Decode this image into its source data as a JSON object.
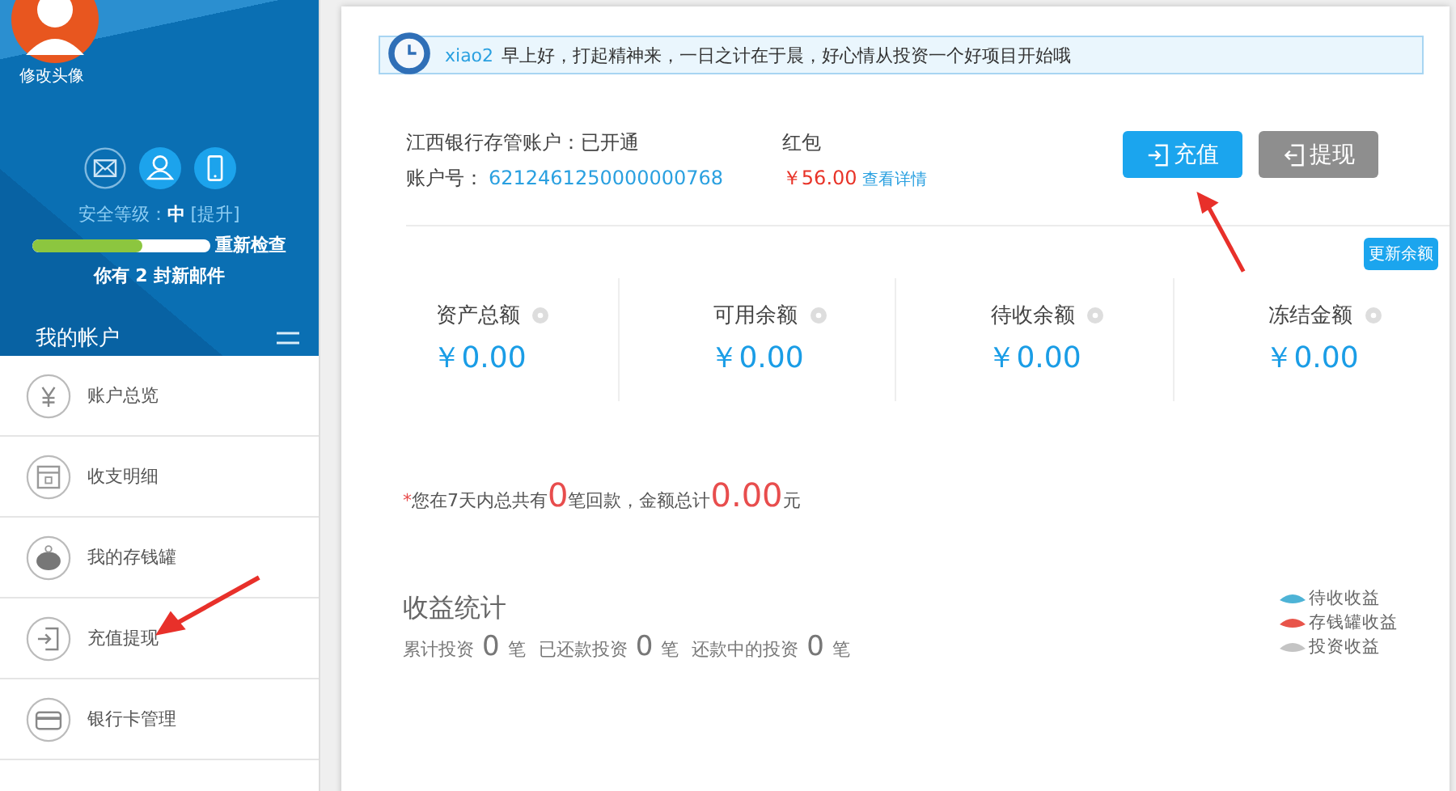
{
  "sidebar": {
    "avatar_label": "修改头像",
    "security_label": "安全等级：",
    "security_value": "中",
    "security_upgrade": "[提升]",
    "security": {
      "level": 0.62
    },
    "recheck": "重新检查",
    "mail_notice": "你有 2 封新邮件",
    "account_title": "我的帐户",
    "menu": [
      {
        "label": "账户总览",
        "selected": false
      },
      {
        "label": "收支明细",
        "selected": false
      },
      {
        "label": "我的存钱罐",
        "selected": false
      },
      {
        "label": "充值提现",
        "selected": false
      },
      {
        "label": "银行卡管理",
        "selected": false
      }
    ]
  },
  "greeting": {
    "user": "xiao2",
    "message": "早上好，打起精神来，一日之计在于晨，好心情从投资一个好项目开始哦"
  },
  "account": {
    "bank_status": "江西银行存管账户：已开通",
    "number_label": "账户号：",
    "number": "6212461250000000768",
    "red_packet_label": "红包",
    "red_packet_amount": "￥56.00",
    "details_link": "查看详情"
  },
  "buttons": [
    {
      "label": "充值",
      "kind": "primary"
    },
    {
      "label": "提现",
      "kind": "secondary"
    }
  ],
  "refresh_button": "更新余额",
  "balances": [
    {
      "label": "资产总额",
      "amount": "￥0.00"
    },
    {
      "label": "可用余额",
      "amount": "￥0.00"
    },
    {
      "label": "待收余额",
      "amount": "￥0.00"
    },
    {
      "label": "冻结金额",
      "amount": "￥0.00"
    }
  ],
  "repayment_notice": [
    {
      "text": "*",
      "kind": "mark"
    },
    {
      "text": "您在7天内总共有",
      "kind": "plain"
    },
    {
      "text": "0",
      "kind": "number"
    },
    {
      "text": "笔回款，金额总计",
      "kind": "plain"
    },
    {
      "text": "0.00",
      "kind": "number"
    },
    {
      "text": "元",
      "kind": "plain"
    }
  ],
  "stats": {
    "title": "收益统计",
    "summary": [
      {
        "text": "累计投资",
        "kind": "plain"
      },
      {
        "text": "0",
        "kind": "number"
      },
      {
        "text": "笔",
        "kind": "plain"
      },
      {
        "text": "已还款投资",
        "kind": "plain"
      },
      {
        "text": "0",
        "kind": "number"
      },
      {
        "text": "笔",
        "kind": "plain"
      },
      {
        "text": "还款中的投资",
        "kind": "plain"
      },
      {
        "text": "0",
        "kind": "number"
      },
      {
        "text": "笔",
        "kind": "plain"
      }
    ],
    "legend": [
      {
        "label": "待收收益",
        "color": "#4db3d6"
      },
      {
        "label": "存钱罐收益",
        "color": "#e8544a"
      },
      {
        "label": "投资收益",
        "color": "#c4c4c4"
      }
    ]
  }
}
